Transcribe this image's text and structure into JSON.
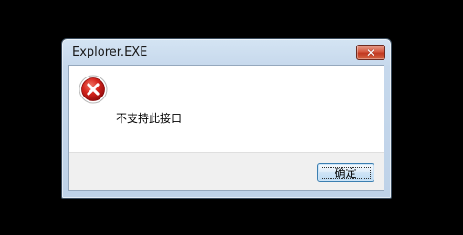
{
  "dialog": {
    "title": "Explorer.EXE",
    "close_glyph": "✕",
    "message": "不支持此接口",
    "ok_label": "确定",
    "icon": "error-icon"
  },
  "colors": {
    "screen_background": "#000000",
    "error_red": "#cc1b1b",
    "close_button_red": "#c23a22",
    "dialog_frame": "#c6d8ec"
  }
}
